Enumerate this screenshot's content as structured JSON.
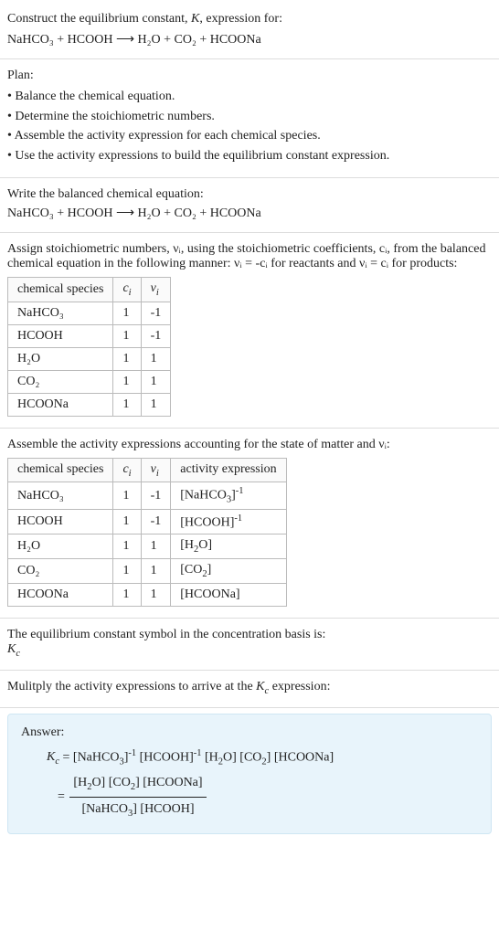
{
  "intro": {
    "title_line1": "Construct the equilibrium constant, K, expression for:",
    "equation": "NaHCO₃ + HCOOH  ⟶  H₂O + CO₂ + HCOONa"
  },
  "plan": {
    "heading": "Plan:",
    "items": [
      "Balance the chemical equation.",
      "Determine the stoichiometric numbers.",
      "Assemble the activity expression for each chemical species.",
      "Use the activity expressions to build the equilibrium constant expression."
    ]
  },
  "balanced": {
    "heading": "Write the balanced chemical equation:",
    "equation": "NaHCO₃ + HCOOH  ⟶  H₂O + CO₂ + HCOONa"
  },
  "assign": {
    "text": "Assign stoichiometric numbers, νᵢ, using the stoichiometric coefficients, cᵢ, from the balanced chemical equation in the following manner: νᵢ = -cᵢ for reactants and νᵢ = cᵢ for products:",
    "headers": [
      "chemical species",
      "cᵢ",
      "νᵢ"
    ],
    "rows": [
      {
        "species": "NaHCO₃",
        "c": "1",
        "v": "-1"
      },
      {
        "species": "HCOOH",
        "c": "1",
        "v": "-1"
      },
      {
        "species": "H₂O",
        "c": "1",
        "v": "1"
      },
      {
        "species": "CO₂",
        "c": "1",
        "v": "1"
      },
      {
        "species": "HCOONa",
        "c": "1",
        "v": "1"
      }
    ]
  },
  "activities": {
    "text": "Assemble the activity expressions accounting for the state of matter and νᵢ:",
    "headers": [
      "chemical species",
      "cᵢ",
      "νᵢ",
      "activity expression"
    ],
    "rows": [
      {
        "species": "NaHCO₃",
        "c": "1",
        "v": "-1",
        "act": "[NaHCO₃]⁻¹"
      },
      {
        "species": "HCOOH",
        "c": "1",
        "v": "-1",
        "act": "[HCOOH]⁻¹"
      },
      {
        "species": "H₂O",
        "c": "1",
        "v": "1",
        "act": "[H₂O]"
      },
      {
        "species": "CO₂",
        "c": "1",
        "v": "1",
        "act": "[CO₂]"
      },
      {
        "species": "HCOONa",
        "c": "1",
        "v": "1",
        "act": "[HCOONa]"
      }
    ]
  },
  "kcsymbol": {
    "line1": "The equilibrium constant symbol in the concentration basis is:",
    "line2": "K_c"
  },
  "multiply": {
    "text": "Mulitply the activity expressions to arrive at the K_c expression:"
  },
  "answer": {
    "label": "Answer:",
    "line1": "K_c = [NaHCO₃]⁻¹ [HCOOH]⁻¹ [H₂O] [CO₂] [HCOONa]",
    "frac_num": "[H₂O] [CO₂] [HCOONa]",
    "frac_den": "[NaHCO₃] [HCOOH]"
  },
  "chart_data": {
    "type": "table",
    "tables": [
      {
        "title": "Stoichiometric numbers",
        "columns": [
          "chemical species",
          "c_i",
          "ν_i"
        ],
        "rows": [
          [
            "NaHCO3",
            1,
            -1
          ],
          [
            "HCOOH",
            1,
            -1
          ],
          [
            "H2O",
            1,
            1
          ],
          [
            "CO2",
            1,
            1
          ],
          [
            "HCOONa",
            1,
            1
          ]
        ]
      },
      {
        "title": "Activity expressions",
        "columns": [
          "chemical species",
          "c_i",
          "ν_i",
          "activity expression"
        ],
        "rows": [
          [
            "NaHCO3",
            1,
            -1,
            "[NaHCO3]^-1"
          ],
          [
            "HCOOH",
            1,
            -1,
            "[HCOOH]^-1"
          ],
          [
            "H2O",
            1,
            1,
            "[H2O]"
          ],
          [
            "CO2",
            1,
            1,
            "[CO2]"
          ],
          [
            "HCOONa",
            1,
            1,
            "[HCOONa]"
          ]
        ]
      }
    ]
  }
}
